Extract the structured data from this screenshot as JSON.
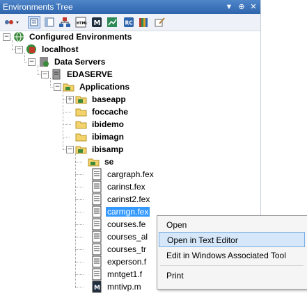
{
  "panel": {
    "title": "Environments Tree"
  },
  "titlebar": {
    "dropdown_glyph": "▼",
    "pin_glyph": "⊕",
    "close_glyph": "✕"
  },
  "toolbar": {
    "icons": [
      "environment-actions-icon",
      "view-list-icon",
      "view-details-icon",
      "network-icon",
      "html-icon",
      "m-report-icon",
      "chart-icon",
      "rc-icon",
      "library-books-icon",
      "compose-icon"
    ]
  },
  "tree": {
    "configured_environments": "Configured Environments",
    "localhost": "localhost",
    "data_servers": "Data Servers",
    "edaserve": "EDASERVE",
    "applications": "Applications",
    "baseapp": "baseapp",
    "foccache": "foccache",
    "ibidemo": "ibidemo",
    "ibimagn": "ibimagn",
    "ibisamp": "ibisamp",
    "se": "se",
    "files": [
      "cargraph.fex",
      "carinst.fex",
      "carinst2.fex",
      "carmgn.fex",
      "courses.fe",
      "courses_al",
      "courses_tr",
      "experson.f",
      "mntget1.f",
      "mntivp.m"
    ]
  },
  "expanders": {
    "minus": "−",
    "plus": "+"
  },
  "context_menu": {
    "items": [
      "Open",
      "Open in Text Editor",
      "Edit in Windows Associated Tool",
      "Print"
    ],
    "hovered": "Open in Text Editor"
  },
  "colors": {
    "titlebar": "#3a72bb",
    "selection": "#3399ff",
    "folder": "#f3d36b",
    "menu_hover": "#d5e7f8"
  }
}
